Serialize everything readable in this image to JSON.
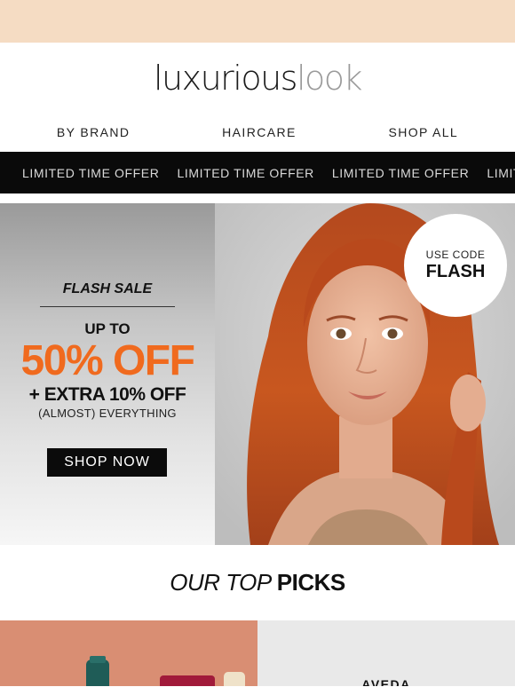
{
  "brand": {
    "logo_main": "luxurious",
    "logo_light": "look"
  },
  "nav": [
    {
      "label": "BY BRAND"
    },
    {
      "label": "HAIRCARE"
    },
    {
      "label": "SHOP ALL"
    }
  ],
  "ticker": {
    "items": [
      "LIMITED TIME OFFER",
      "LIMITED TIME OFFER",
      "LIMITED TIME OFFER",
      "LIMITED TIME OFFER"
    ]
  },
  "hero": {
    "flash_title": "FLASH SALE",
    "up_to": "UP TO",
    "discount": "50% OFF",
    "extra": "+ EXTRA 10% OFF",
    "almost": "(ALMOST) EVERYTHING",
    "cta": "SHOP NOW",
    "badge_small": "USE CODE",
    "badge_big": "FLASH"
  },
  "picks": {
    "light": "OUR TOP",
    "bold": "PICKS"
  },
  "products": {
    "right_label": "AVEDA"
  },
  "colors": {
    "topbar": "#f5dcc3",
    "accent": "#f06a1e",
    "ticker_bg": "#0a0a0a"
  }
}
